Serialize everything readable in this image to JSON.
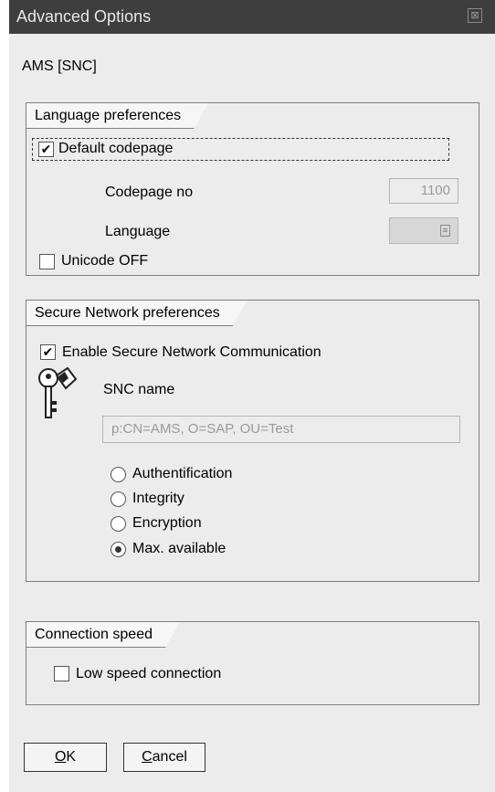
{
  "window": {
    "title": "Advanced Options",
    "close_symbol": "⊠"
  },
  "subtitle": "AMS [SNC]",
  "language_group": {
    "title": "Language preferences",
    "default_codepage": {
      "label": "Default codepage",
      "checked": true
    },
    "codepage_no": {
      "label": "Codepage no",
      "value": "1100"
    },
    "language": {
      "label": "Language",
      "value": ""
    },
    "unicode_off": {
      "label": "Unicode OFF",
      "checked": false
    }
  },
  "snc_group": {
    "title": "Secure Network preferences",
    "enable_snc": {
      "label": "Enable Secure Network Communication",
      "checked": true
    },
    "snc_name": {
      "label": "SNC name",
      "value": "p:CN=AMS, O=SAP, OU=Test"
    },
    "protection_levels": [
      {
        "label": "Authentification",
        "selected": false
      },
      {
        "label": "Integrity",
        "selected": false
      },
      {
        "label": "Encryption",
        "selected": false
      },
      {
        "label": "Max. available",
        "selected": true
      }
    ]
  },
  "speed_group": {
    "title": "Connection speed",
    "low_speed": {
      "label": "Low speed connection",
      "checked": false
    }
  },
  "buttons": {
    "ok": {
      "mnemonic": "O",
      "rest": "K"
    },
    "cancel": {
      "mnemonic": "C",
      "rest": "ancel"
    }
  },
  "check_glyph": "✔"
}
